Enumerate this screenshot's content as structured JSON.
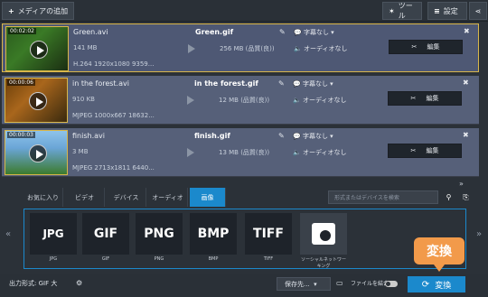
{
  "top": {
    "add_media": "メディアの追加",
    "tools": "ツール",
    "settings": "設定"
  },
  "files": [
    {
      "time": "00:02:02",
      "name": "Green.avi",
      "size": "141 MB",
      "info": "H.264 1920x1080 9359...",
      "output_name": "Green.gif",
      "output_size": "256 MB (品質(良))",
      "subtitle": "字幕なし",
      "audio": "オーディオなし",
      "edit": "編集"
    },
    {
      "time": "00:00:06",
      "name": "in the forest.avi",
      "size": "910 KB",
      "info": "MJPEG 1000x667 18632...",
      "output_name": "in the forest.gif",
      "output_size": "12 MB (品質(良))",
      "subtitle": "字幕なし",
      "audio": "オーディオなし",
      "edit": "編集"
    },
    {
      "time": "00:00:03",
      "name": "finish.avi",
      "size": "3 MB",
      "info": "MJPEG 2713x1811 6440...",
      "output_name": "finish.gif",
      "output_size": "13 MB (品質(良))",
      "subtitle": "字幕なし",
      "audio": "オーディオなし",
      "edit": "編集"
    }
  ],
  "tabs": [
    "お気に入り",
    "ビデオ",
    "デバイス",
    "オーディオ",
    "画像"
  ],
  "search_placeholder": "形式またはデバイスを検索",
  "formats": [
    {
      "label": "JPG",
      "caption": "JPG"
    },
    {
      "label": "GIF",
      "caption": "GIF"
    },
    {
      "label": "PNG",
      "caption": "PNG"
    },
    {
      "label": "BMP",
      "caption": "BMP"
    },
    {
      "label": "TIFF",
      "caption": "TIFF"
    },
    {
      "label": "",
      "caption": "ソーシャルネットワーキング"
    }
  ],
  "bottom": {
    "output_format": "出力形式: GIF 大",
    "save_to": "保存先...",
    "merge": "ファイルを結合",
    "convert": "変換",
    "callout": "変換"
  },
  "colors": {
    "accent": "#1b89cc",
    "callout": "#f29a4a",
    "selected_border": "#d8b64a"
  }
}
